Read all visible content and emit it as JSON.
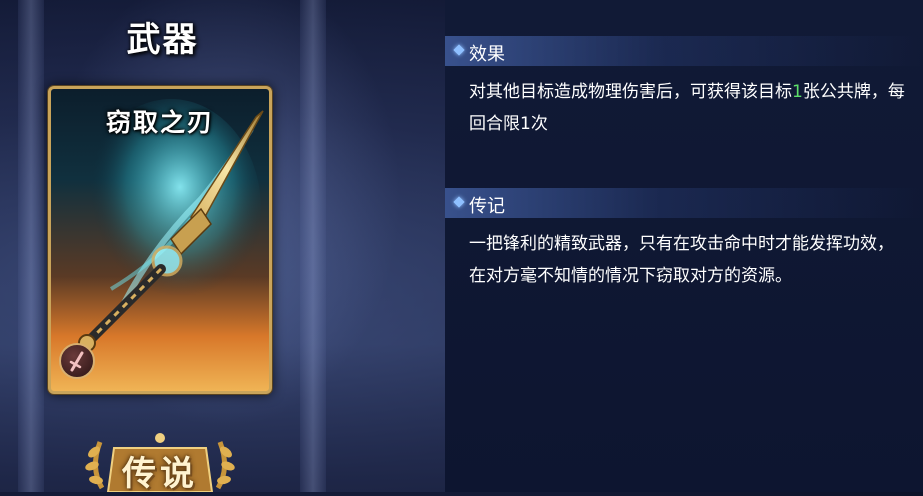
{
  "category_title": "武器",
  "card": {
    "name": "窃取之刃",
    "type_icon": "dagger-icon"
  },
  "rarity": {
    "label": "传说",
    "emblem_icon": "laurel-wreath-icon"
  },
  "sections": {
    "effect": {
      "title": "效果",
      "text_before": "对其他目标造成物理伤害后，可获得该目标",
      "highlight": "1",
      "text_after": "张公共牌，每回合限1次",
      "highlight_color": "#5de06a"
    },
    "lore": {
      "title": "传记",
      "text": "一把锋利的精致武器，只有在攻击命中时才能发挥功效，在对方毫不知情的情况下窃取对方的资源。"
    }
  }
}
